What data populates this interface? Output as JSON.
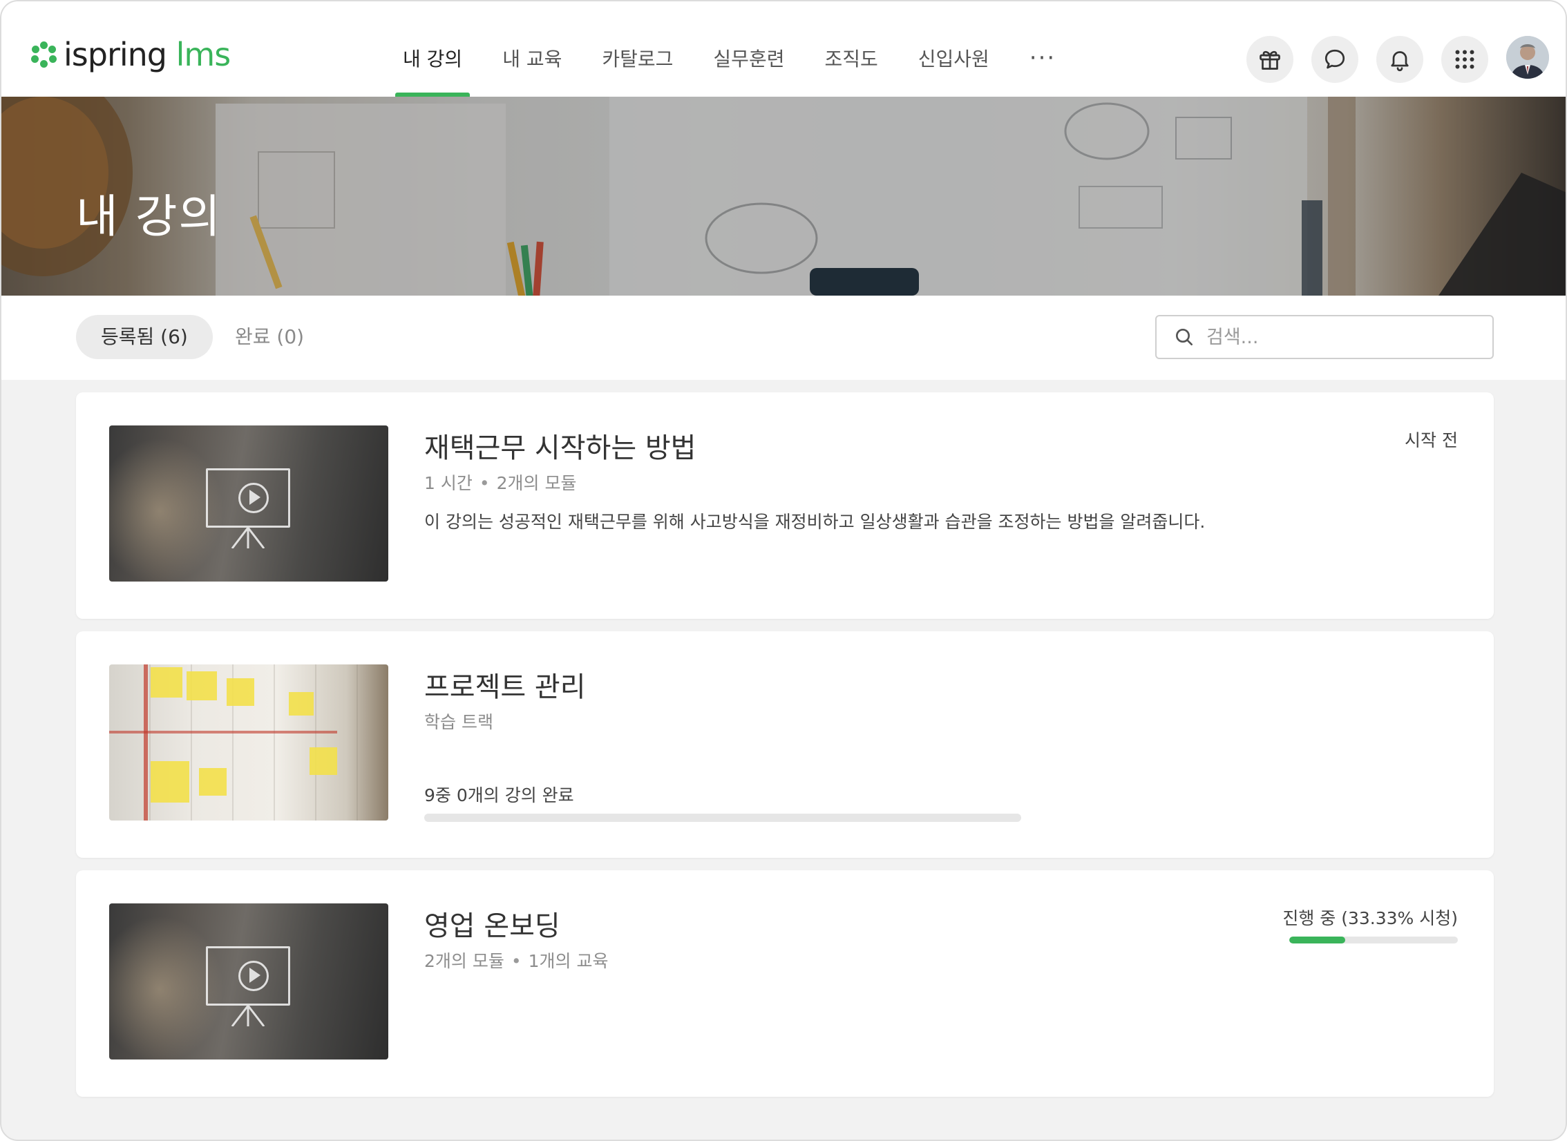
{
  "header": {
    "logo_main": "ispring",
    "logo_accent": "lms",
    "nav": [
      {
        "label": "내 강의",
        "active": true
      },
      {
        "label": "내 교육",
        "active": false
      },
      {
        "label": "카탈로그",
        "active": false
      },
      {
        "label": "실무훈련",
        "active": false
      },
      {
        "label": "조직도",
        "active": false
      },
      {
        "label": "신입사원",
        "active": false
      }
    ],
    "more_label": "···",
    "icons": [
      "gift-icon",
      "chat-icon",
      "bell-icon",
      "apps-grid-icon"
    ]
  },
  "hero": {
    "title": "내 강의"
  },
  "tabs": {
    "enrolled": "등록됨 (6)",
    "completed": "완료 (0)"
  },
  "search": {
    "placeholder": "검색..."
  },
  "courses": [
    {
      "title": "재택근무 시작하는 방법",
      "meta": [
        "1 시간",
        "2개의 모듈"
      ],
      "description": "이 강의는 성공적인 재택근무를 위해 사고방식을 재정비하고 일상생활과 습관을 조정하는 방법을 알려줍니다.",
      "status": "시작 전",
      "thumbnail": "video"
    },
    {
      "title": "프로젝트 관리",
      "meta": [
        "학습 트랙"
      ],
      "progress_label": "9중 0개의 강의 완료",
      "progress": 0,
      "thumbnail": "board"
    },
    {
      "title": "영업 온보딩",
      "meta": [
        "2개의 모듈",
        "1개의 교육"
      ],
      "status": "진행 중 (33.33% 시청)",
      "progress": 0.3333,
      "thumbnail": "video"
    }
  ],
  "colors": {
    "accent": "#3ab45a",
    "track": "#e6e6e6",
    "background": "#f2f2f2"
  }
}
